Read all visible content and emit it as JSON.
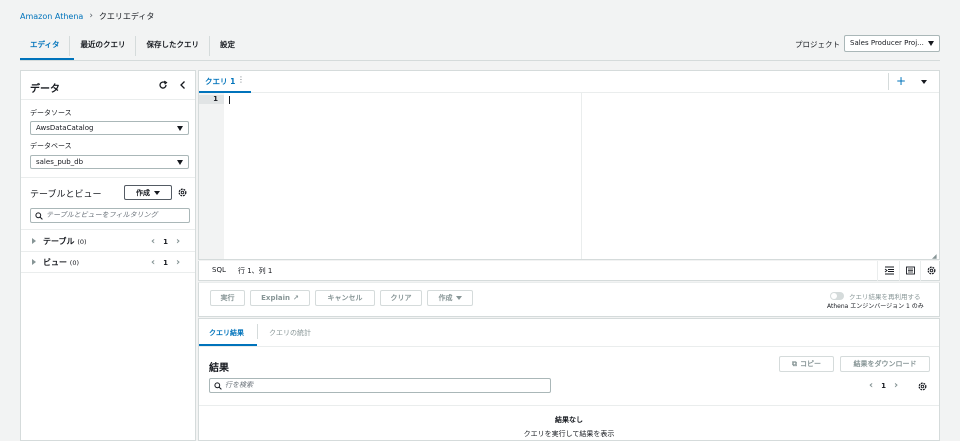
{
  "breadcrumb": {
    "root": "Amazon Athena",
    "current": "クエリエディタ"
  },
  "tabs": [
    {
      "label": "エディタ",
      "active": true
    },
    {
      "label": "最近のクエリ",
      "active": false
    },
    {
      "label": "保存したクエリ",
      "active": false
    },
    {
      "label": "設定",
      "active": false
    }
  ],
  "project": {
    "label": "プロジェクト",
    "value": "Sales Producer Proj..."
  },
  "data_panel": {
    "title": "データ",
    "datasource_label": "データソース",
    "datasource_value": "AwsDataCatalog",
    "database_label": "データベース",
    "database_value": "sales_pub_db",
    "tables_views_heading": "テーブルとビュー",
    "create_label": "作成",
    "filter_placeholder": "テーブルとビューをフィルタリング",
    "tree": [
      {
        "label": "テーブル",
        "count": "(0)",
        "page": "1"
      },
      {
        "label": "ビュー",
        "count": "(0)",
        "page": "1"
      }
    ]
  },
  "editor": {
    "tab_label": "クエリ 1",
    "line_number": "1",
    "language": "SQL",
    "position": "行 1、列 1"
  },
  "actions": {
    "run": "実行",
    "explain": "Explain",
    "cancel": "キャンセル",
    "clear": "クリア",
    "create": "作成",
    "reuse_toggle_label": "クエリ結果を再利用する",
    "engine_note": "Athena エンジンバージョン 1 のみ"
  },
  "results": {
    "tab_results": "クエリ結果",
    "tab_stats": "クエリの統計",
    "title": "結果",
    "copy_label": "コピー",
    "download_label": "結果をダウンロード",
    "search_placeholder": "行を検索",
    "page": "1",
    "empty_title": "結果なし",
    "empty_sub": "クエリを実行して結果を表示"
  },
  "colors": {
    "accent": "#0073bb",
    "border": "#d5dbdb",
    "background": "#f2f3f3",
    "disabled": "#879596"
  }
}
